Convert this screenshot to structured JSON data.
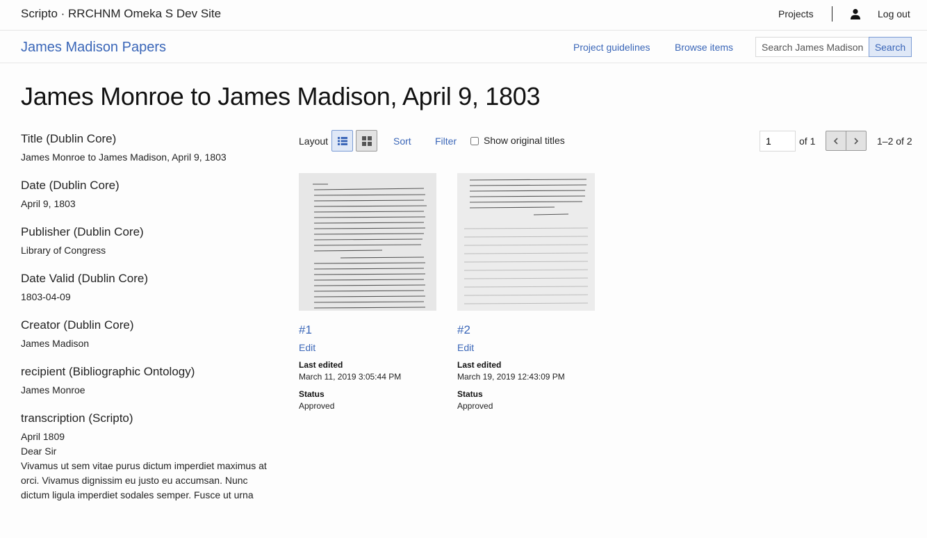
{
  "topbar": {
    "site_title": "Scripto · RRCHNM Omeka S Dev Site",
    "projects_label": "Projects",
    "logout_label": "Log out"
  },
  "project_bar": {
    "title": "James Madison Papers",
    "nav": {
      "guidelines": "Project guidelines",
      "browse": "Browse items"
    },
    "search": {
      "placeholder": "Search James Madison Papers",
      "button_label": "Search"
    }
  },
  "page_title": "James Monroe to James Madison, April 9, 1803",
  "metadata": [
    {
      "label": "Title (Dublin Core)",
      "value": "James Monroe to James Madison, April 9, 1803"
    },
    {
      "label": "Date (Dublin Core)",
      "value": "April 9, 1803"
    },
    {
      "label": "Publisher (Dublin Core)",
      "value": "Library of Congress"
    },
    {
      "label": "Date Valid (Dublin Core)",
      "value": "1803-04-09"
    },
    {
      "label": "Creator (Dublin Core)",
      "value": "James Madison"
    },
    {
      "label": "recipient (Bibliographic Ontology)",
      "value": "James Monroe"
    },
    {
      "label": "transcription (Scripto)",
      "lines": [
        "April 1809",
        "Dear Sir",
        "Vivamus ut sem vitae purus dictum imperdiet maximus at",
        "orci. Vivamus dignissim eu justo eu accumsan. Nunc",
        "dictum ligula imperdiet sodales semper. Fusce ut urna"
      ]
    }
  ],
  "toolbar": {
    "layout_label": "Layout",
    "sort_label": "Sort",
    "filter_label": "Filter",
    "show_original_titles_label": "Show original titles",
    "show_original_titles_checked": false,
    "page_value": "1",
    "page_of": "of 1",
    "range": "1–2 of 2"
  },
  "items": [
    {
      "number": "#1",
      "edit_label": "Edit",
      "last_edited_label": "Last edited",
      "last_edited": "March 11, 2019 3:05:44 PM",
      "status_label": "Status",
      "status": "Approved"
    },
    {
      "number": "#2",
      "edit_label": "Edit",
      "last_edited_label": "Last edited",
      "last_edited": "March 19, 2019 12:43:09 PM",
      "status_label": "Status",
      "status": "Approved"
    }
  ],
  "colors": {
    "accent": "#3a66b8",
    "active_button_bg": "#dfe8f7",
    "border": "#e6e6e6"
  },
  "icons": [
    "user-icon",
    "list-layout-icon",
    "grid-layout-icon",
    "chevron-left-icon",
    "chevron-right-icon"
  ]
}
